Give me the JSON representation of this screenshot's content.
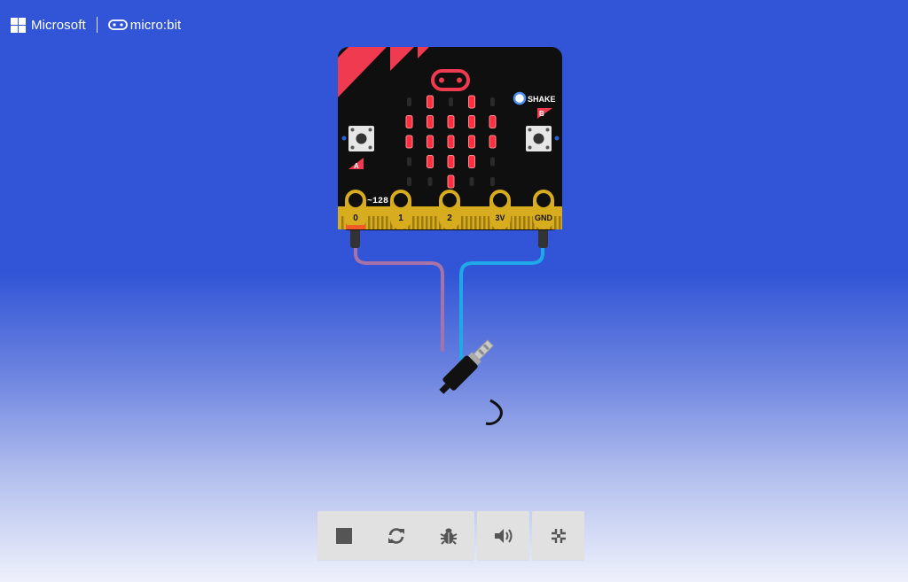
{
  "brand": {
    "company": "Microsoft",
    "product": "micro:bit"
  },
  "board": {
    "shake_label": "SHAKE",
    "button_a_label": "A",
    "button_b_label": "B",
    "pin0_value": "~128",
    "pins": [
      "0",
      "1",
      "2",
      "3V",
      "GND"
    ],
    "led_matrix": [
      [
        0,
        1,
        0,
        1,
        0
      ],
      [
        1,
        1,
        1,
        1,
        1
      ],
      [
        1,
        1,
        1,
        1,
        1
      ],
      [
        0,
        1,
        1,
        1,
        0
      ],
      [
        0,
        0,
        1,
        0,
        0
      ]
    ]
  },
  "wires": {
    "pin0_color": "#a672a8",
    "gnd_color": "#1fa9e6"
  },
  "toolbar": {
    "buttons": [
      {
        "icon": "stop-icon"
      },
      {
        "icon": "restart-icon"
      },
      {
        "icon": "debug-icon"
      },
      {
        "icon": "mute-icon"
      },
      {
        "icon": "fullscreen-icon"
      }
    ]
  }
}
